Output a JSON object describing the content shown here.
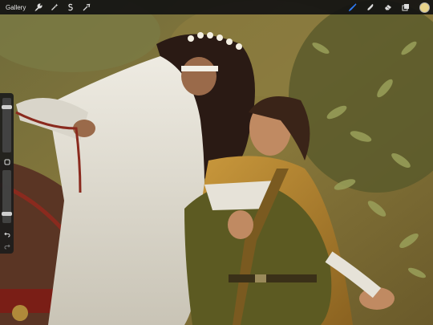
{
  "topbar": {
    "gallery_label": "Gallery",
    "left_tools": [
      "wrench-icon",
      "magic-wand-icon",
      "selection-icon",
      "transform-icon"
    ],
    "right_tools": [
      "brush-icon",
      "smudge-icon",
      "eraser-icon",
      "layers-icon"
    ],
    "active_tool": "brush-icon",
    "active_color": "#e8d38a",
    "accent_color": "#2f7bf5"
  },
  "sidebar": {
    "brush_size": 0.85,
    "brush_opacity": 0.15,
    "buttons": [
      "modify-button-icon",
      "undo-icon",
      "redo-icon"
    ]
  }
}
